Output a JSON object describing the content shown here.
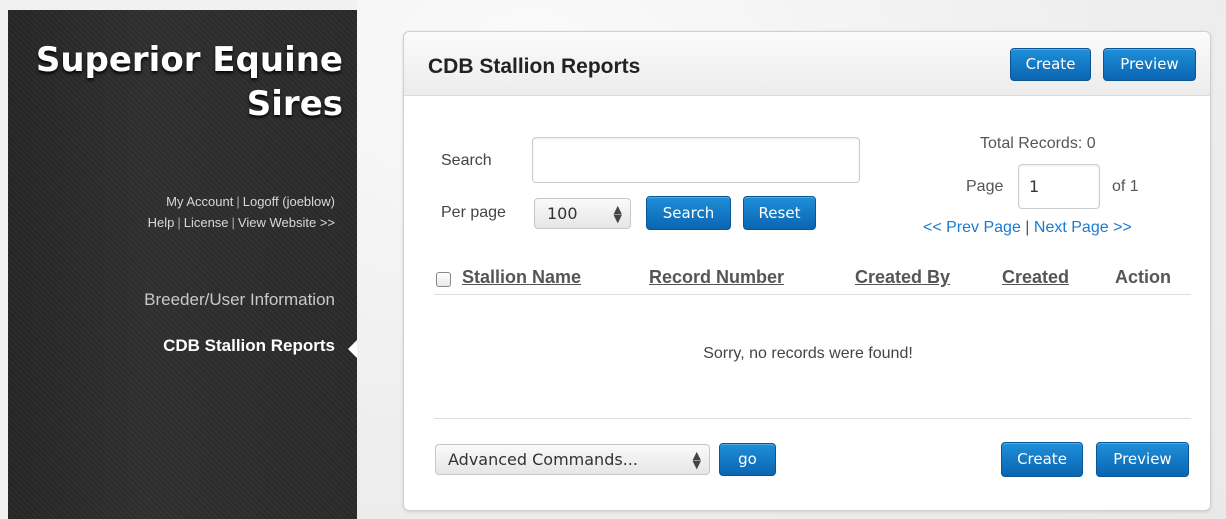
{
  "sidebar": {
    "site_title": "Superior Equine Sires",
    "links_row1": [
      "My Account",
      "Logoff (joeblow)"
    ],
    "links_row2": [
      "Help",
      "License",
      "View Website >>"
    ],
    "nav": [
      {
        "label": "Breeder/User Information",
        "active": false
      },
      {
        "label": "CDB Stallion Reports",
        "active": true
      }
    ]
  },
  "panel": {
    "title": "CDB Stallion Reports",
    "header_buttons": {
      "create": "Create",
      "preview": "Preview"
    },
    "search": {
      "label": "Search",
      "value": "",
      "per_page_label": "Per page",
      "per_page_value": "100",
      "search_button": "Search",
      "reset_button": "Reset"
    },
    "pagination": {
      "total_records": "Total Records: 0",
      "page_label": "Page",
      "page_value": "1",
      "of_label": "of 1",
      "prev": "<< Prev Page",
      "separator": "|",
      "next": "Next Page >>"
    },
    "table": {
      "columns": [
        "Stallion Name",
        "Record Number",
        "Created By",
        "Created",
        "Action"
      ],
      "empty_message": "Sorry, no records were found!"
    },
    "footer": {
      "advanced_commands": "Advanced Commands...",
      "go_button": "go",
      "create": "Create",
      "preview": "Preview"
    }
  },
  "colors": {
    "button_blue": "#0a65b2",
    "link_blue": "#1a7bd0",
    "sidebar_bg": "#2a2a2a"
  }
}
